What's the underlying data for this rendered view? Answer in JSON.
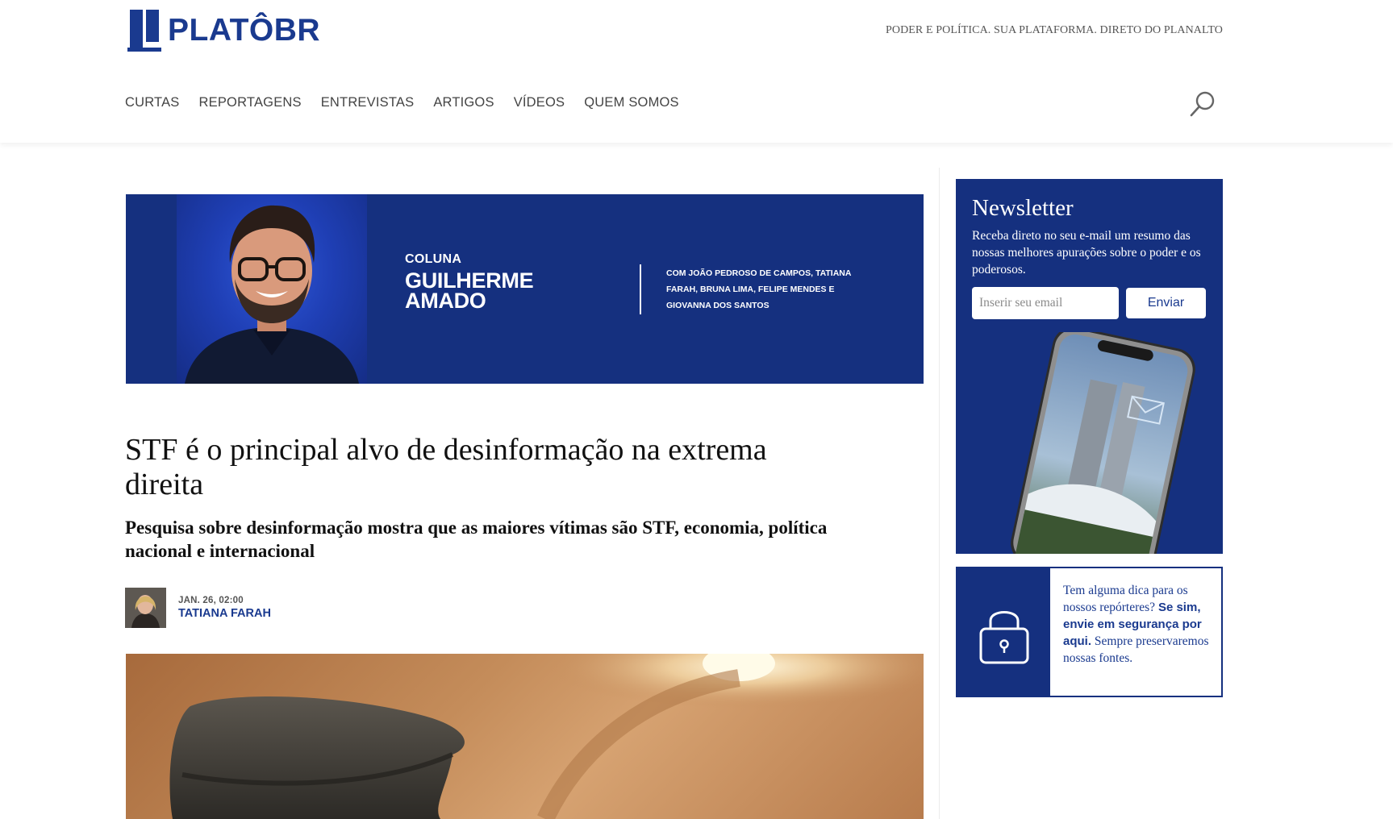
{
  "site": {
    "logo_text": "PLATÔBR",
    "tagline": "PODER E POLÍTICA. SUA PLATAFORMA. DIRETO DO PLANALTO"
  },
  "nav": {
    "items": [
      {
        "label": "CURTAS"
      },
      {
        "label": "REPORTAGENS"
      },
      {
        "label": "ENTREVISTAS"
      },
      {
        "label": "ARTIGOS"
      },
      {
        "label": "VÍDEOS"
      },
      {
        "label": "QUEM SOMOS"
      }
    ],
    "search_icon": "search-icon"
  },
  "column_banner": {
    "label": "COLUNA",
    "name": "GUILHERME AMADO",
    "credits": "COM JOÃO PEDROSO DE CAMPOS, TATIANA FARAH, BRUNA LIMA, FELIPE MENDES E GIOVANNA DOS SANTOS"
  },
  "article": {
    "headline": "STF é o principal alvo de desinformação na extrema direita",
    "subheadline": "Pesquisa sobre desinformação mostra que as maiores vítimas são STF, economia, política nacional e internacional",
    "date": "JAN. 26, 02:00",
    "author": "TATIANA FARAH"
  },
  "newsletter": {
    "title": "Newsletter",
    "description": "Receba direto no seu e-mail um resumo das nossas melhores apurações sobre o poder e os poderosos.",
    "email_placeholder": "Inserir seu email",
    "submit_label": "Enviar"
  },
  "tip": {
    "text_before": "Tem alguma dica para os nossos repórteres? ",
    "link_text": "Se sim, envie em segurança por aqui.",
    "text_after": " Sempre preservaremos nossas fontes.",
    "icon": "lock-icon"
  },
  "colors": {
    "brand_blue": "#15307f",
    "link_blue": "#1a3a8f"
  }
}
